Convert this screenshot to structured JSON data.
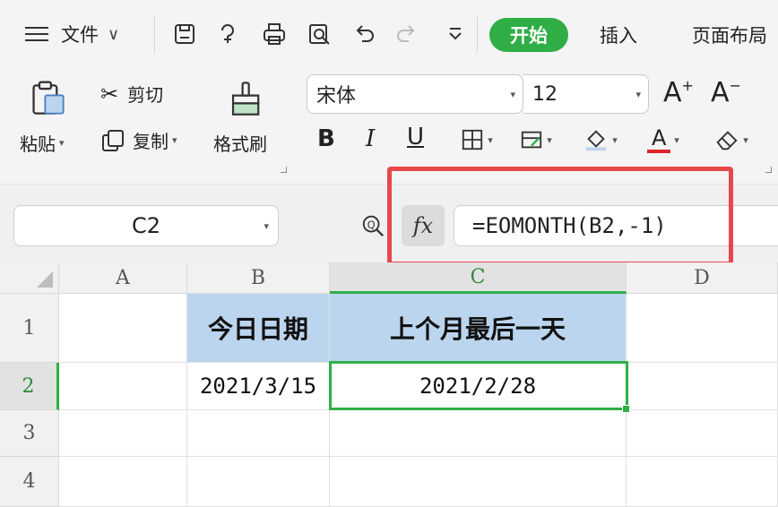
{
  "menu": {
    "file_label": "文件"
  },
  "tabs": {
    "start": "开始",
    "insert": "插入",
    "layout": "页面布局"
  },
  "ribbon": {
    "paste": "粘贴",
    "cut": "剪切",
    "copy": "复制",
    "format_painter": "格式刷",
    "font_name": "宋体",
    "font_size": "12",
    "grow_font": "A",
    "shrink_font": "A",
    "bold": "B",
    "italic": "I",
    "underline": "U",
    "font_color_glyph": "A"
  },
  "colors": {
    "accent": "#2fae46",
    "highlight": "#e8474b",
    "header_fill": "#bcd5ee",
    "font_color_bar": "#e0242b"
  },
  "formula_bar": {
    "name_box": "C2",
    "fx_label": "fx",
    "formula": "=EOMONTH(B2,-1)"
  },
  "sheet": {
    "columns": [
      "A",
      "B",
      "C",
      "D"
    ],
    "rows": [
      "1",
      "2",
      "3",
      "4"
    ],
    "B1": "今日日期",
    "C1": "上个月最后一天",
    "B2": "2021/3/15",
    "C2": "2021/2/28"
  }
}
